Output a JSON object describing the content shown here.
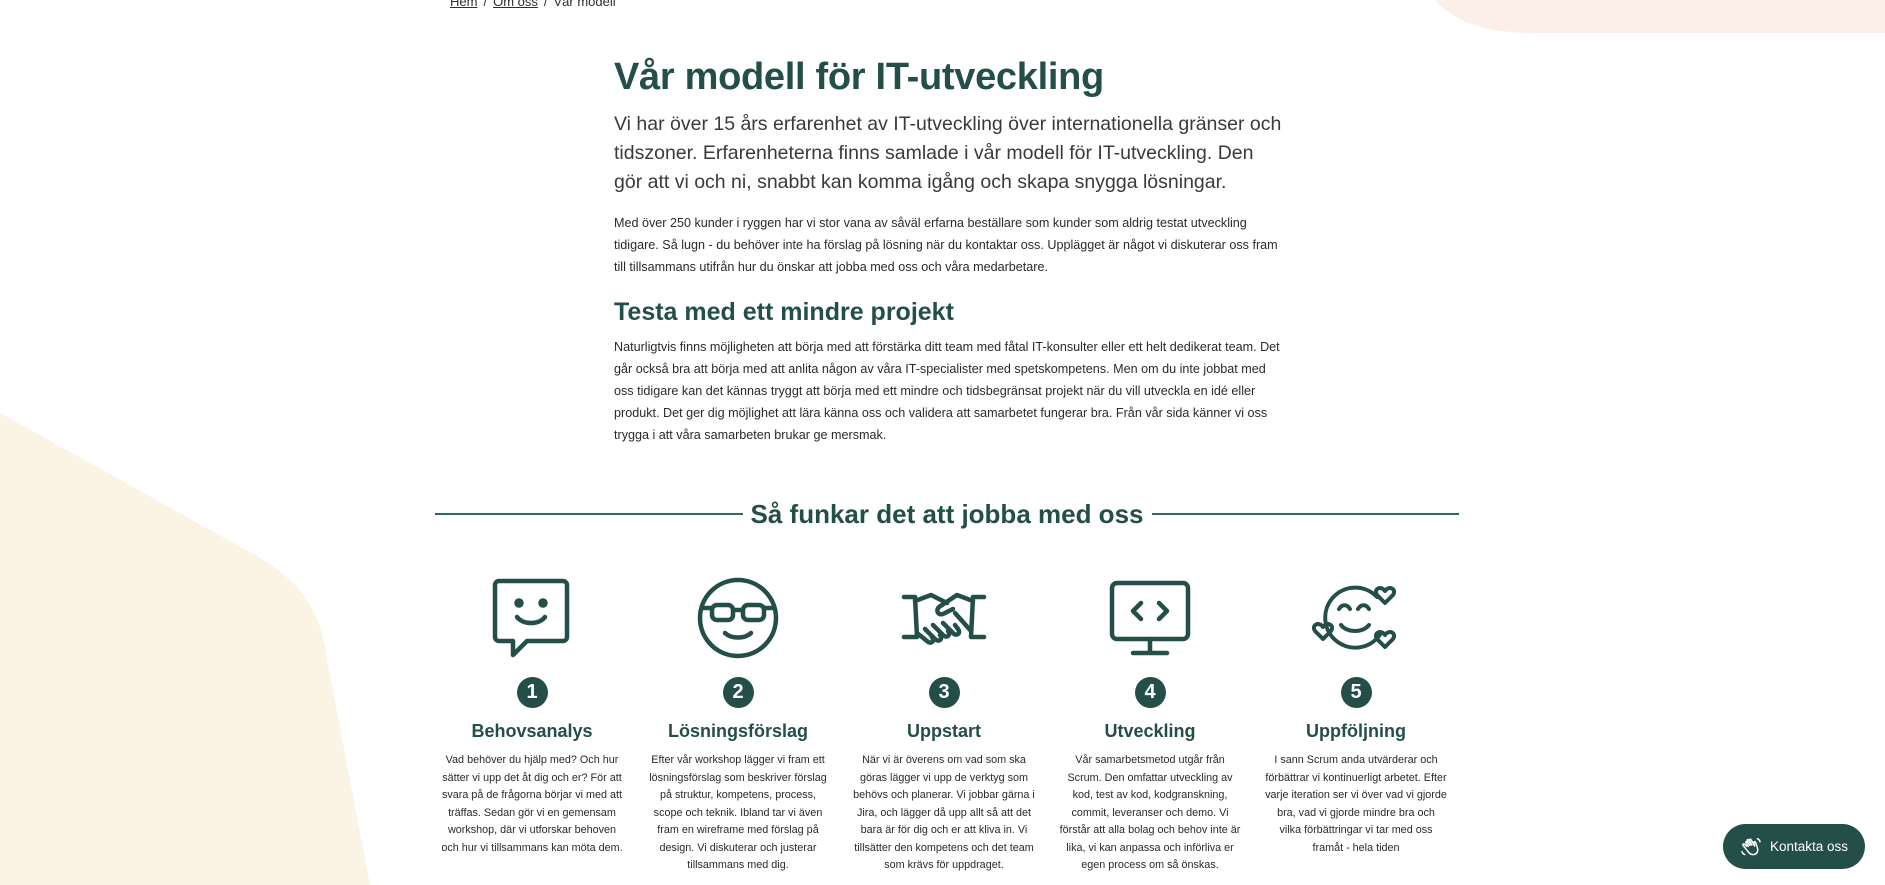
{
  "breadcrumb": {
    "items": [
      {
        "label": "Hem"
      },
      {
        "label": "Om oss"
      },
      {
        "label": "Vår modell"
      }
    ],
    "separator": "/"
  },
  "article": {
    "title": "Vår modell för IT-utveckling",
    "lead": "Vi har över 15 års erfarenhet av IT-utveckling över internationella gränser och tidszoner. Erfarenheterna finns samlade i vår modell för IT-utveckling. Den gör att vi och ni, snabbt kan komma igång och skapa snygga lösningar.",
    "paragraph1": "Med över 250 kunder i ryggen har vi stor vana av såväl erfarna beställare som kunder som aldrig testat utveckling tidigare. Så lugn - du behöver inte ha förslag på lösning när du kontaktar oss. Upplägget är något vi diskuterar oss fram till tillsammans utifrån hur du önskar att jobba med oss och våra medarbetare.",
    "subheading": "Testa med ett mindre projekt",
    "paragraph2": "Naturligtvis finns möjligheten att börja med att förstärka ditt team med fåtal IT-konsulter eller ett helt dedikerat team. Det går också bra att börja med att anlita någon av våra IT-specialister med spetskompetens. Men om du inte jobbat med oss tidigare kan det kännas tryggt att börja med ett mindre och tidsbegränsat projekt när du vill utveckla en idé eller produkt. Det ger dig möjlighet att lära känna oss och validera att samarbetet fungerar bra. Från vår sida känner vi oss trygga i att våra samarbeten brukar ge mersmak."
  },
  "process": {
    "heading": "Så funkar det att jobba med oss",
    "steps": [
      {
        "number": "1",
        "icon": "chat-smile-icon",
        "title": "Behovsanalys",
        "text": "Vad behöver du hjälp med? Och hur sätter vi upp det åt dig och er? För att svara på de frågorna börjar vi med att träffas. Sedan gör vi en gemensam workshop, där vi utforskar behoven och hur vi tillsammans kan möta dem."
      },
      {
        "number": "2",
        "icon": "glasses-face-icon",
        "title": "Lösningsförslag",
        "text": "Efter vår workshop lägger vi fram ett lösningsförslag som beskriver förslag på struktur, kompetens, process, scope och teknik. Ibland tar vi även fram en wireframe med förslag på design. Vi diskuterar och justerar tillsammans med dig."
      },
      {
        "number": "3",
        "icon": "handshake-icon",
        "title": "Uppstart",
        "text": "När vi är överens om vad som ska göras lägger vi upp de verktyg som behövs och planerar. Vi jobbar gärna i Jira, och lägger då upp allt så att det bara är för dig och er att kliva in. Vi tillsätter den kompetens och det team som krävs för uppdraget."
      },
      {
        "number": "4",
        "icon": "code-monitor-icon",
        "title": "Utveckling",
        "text": "Vår samarbetsmetod utgår från Scrum. Den omfattar utveckling av kod, test av kod, kodgranskning, commit, leveranser och demo. Vi förstår att alla bolag och behov inte är lika, vi kan anpassa och införliva er egen process om så önskas."
      },
      {
        "number": "5",
        "icon": "happy-hearts-icon",
        "title": "Uppföljning",
        "text": "I sann Scrum anda utvärderar och förbättrar vi kontinuerligt arbetet. Efter varje iteration ser vi över vad vi gjorde bra, vad vi gjorde mindre bra och vilka förbättringar vi tar med oss framåt - hela tiden"
      }
    ]
  },
  "contact": {
    "label": "Kontakta oss",
    "icon": "waving-hand-icon"
  },
  "colors": {
    "brand": "#234f48",
    "beige": "#fbf3e3",
    "pink": "#fcefea"
  }
}
